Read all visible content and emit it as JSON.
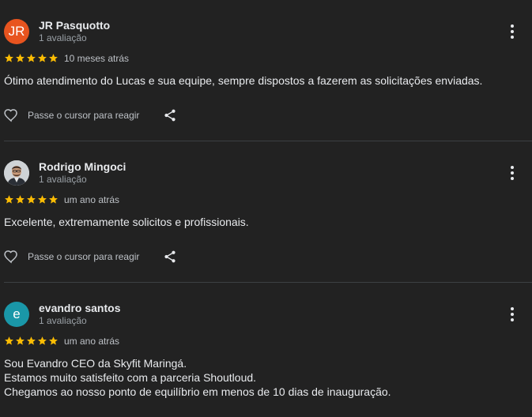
{
  "colors": {
    "background": "#222222",
    "star": "#fbbc04",
    "divider": "#3c4043"
  },
  "reviews": [
    {
      "avatar_initials": "JR",
      "avatar_color": "#e8541f",
      "avatar_type": "initials",
      "name": "JR Pasquotto",
      "review_count": "1 avaliação",
      "rating": 5,
      "time": "10 meses atrás",
      "text": "Ótimo atendimento do Lucas e sua equipe, sempre dispostos a fazerem as solicitações enviadas.",
      "react_label": "Passe o cursor para reagir"
    },
    {
      "avatar_initials": "",
      "avatar_color": "#d9d9d9",
      "avatar_type": "photo",
      "name": "Rodrigo Mingoci",
      "review_count": "1 avaliação",
      "rating": 5,
      "time": "um ano atrás",
      "text": "Excelente, extremamente solicitos e profissionais.",
      "react_label": "Passe o cursor para reagir"
    },
    {
      "avatar_initials": "e",
      "avatar_color": "#1a97a8",
      "avatar_type": "initials",
      "name": "evandro santos",
      "review_count": "1 avaliação",
      "rating": 5,
      "time": "um ano atrás",
      "text": "Sou Evandro CEO da Skyfit Maringá.\nEstamos muito satisfeito com a parceria Shoutloud.\nChegamos ao nosso ponto de equilíbrio em menos de 10 dias de inauguração.",
      "react_label": ""
    }
  ]
}
